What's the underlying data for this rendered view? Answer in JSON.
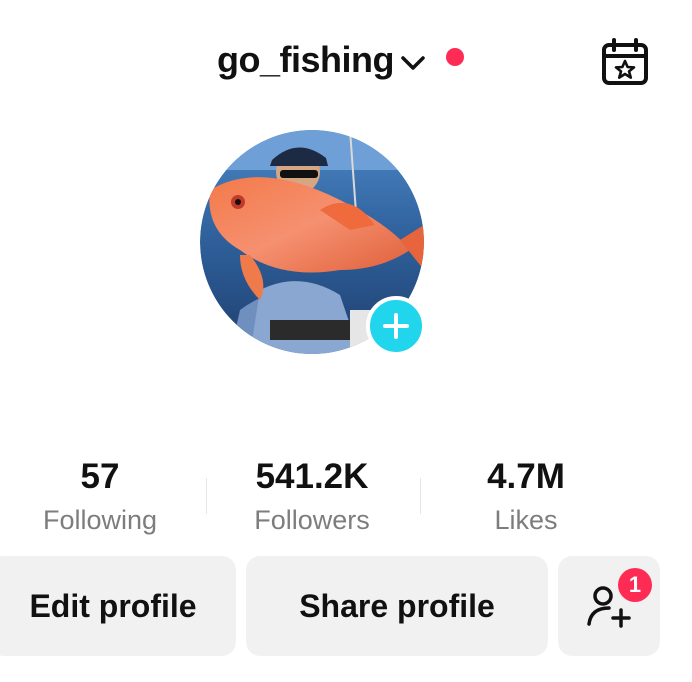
{
  "header": {
    "username": "go_fishing",
    "account_switch_icon": "chevron-down-icon",
    "calendar_icon": "calendar-star-icon"
  },
  "avatar": {
    "description_icon": "profile-photo",
    "add_icon": "plus-icon"
  },
  "stats": [
    {
      "value": "57",
      "label": "Following"
    },
    {
      "value": "541.2K",
      "label": "Followers"
    },
    {
      "value": "4.7M",
      "label": "Likes"
    }
  ],
  "actions": {
    "edit_label": "Edit profile",
    "share_label": "Share profile",
    "add_friends_icon": "add-user-icon",
    "add_friends_badge": "1"
  },
  "colors": {
    "accent_red": "#fe2c55",
    "accent_cyan": "#20d5ec",
    "button_bg": "#f1f1f2",
    "secondary_text": "#7d7d7d"
  }
}
